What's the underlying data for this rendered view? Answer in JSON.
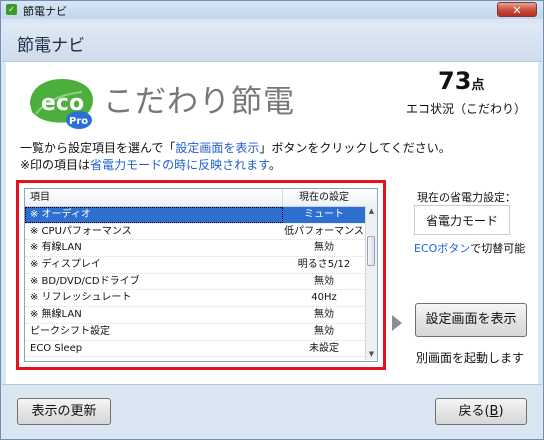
{
  "window": {
    "title": "節電ナビ",
    "close_label": "✕"
  },
  "header": {
    "title": "節電ナビ"
  },
  "hero": {
    "logo_text": "eco",
    "logo_badge": "Pro",
    "title": "こだわり節電",
    "score": "73",
    "score_unit": "点",
    "status_label": "エコ状況（こだわり）"
  },
  "instructions": {
    "line1_before": "一覧から設定項目を選んで「",
    "line1_link": "設定画面を表示",
    "line1_after": "」ボタンをクリックしてください。",
    "line2_before": "※印の項目は",
    "line2_link": "省電力モードの時に反映されます",
    "line2_after": "。"
  },
  "list": {
    "columns": [
      "項目",
      "現在の設定"
    ],
    "rows": [
      {
        "item": "※ オーディオ",
        "value": "ミュート",
        "selected": true
      },
      {
        "item": "※ CPUパフォーマンス",
        "value": "低パフォーマンス",
        "selected": false
      },
      {
        "item": "※ 有線LAN",
        "value": "無効",
        "selected": false
      },
      {
        "item": "※ ディスプレイ",
        "value": "明るさ5/12",
        "selected": false
      },
      {
        "item": "※ BD/DVD/CDドライブ",
        "value": "無効",
        "selected": false
      },
      {
        "item": "※ リフレッシュレート",
        "value": "40Hz",
        "selected": false
      },
      {
        "item": "※ 無線LAN",
        "value": "無効",
        "selected": false
      },
      {
        "item": "ピークシフト設定",
        "value": "無効",
        "selected": false
      },
      {
        "item": "ECO Sleep",
        "value": "未設定",
        "selected": false
      }
    ]
  },
  "side": {
    "current_label": "現在の省電力設定：",
    "current_value": "省電力モード",
    "eco_note_link": "ECOボタン",
    "eco_note_after": "で切替可能",
    "setting_button": "設定画面を表示",
    "setting_note": "別画面を起動します"
  },
  "footer": {
    "refresh_button": "表示の更新",
    "back_button_before": "戻る(",
    "back_button_key": "B",
    "back_button_after": ")"
  },
  "colors": {
    "accent_blue": "#1f5fd1",
    "highlight_red": "#e3111b",
    "eco_green": "#4caf3c",
    "eco_blue": "#2c6fd6"
  }
}
